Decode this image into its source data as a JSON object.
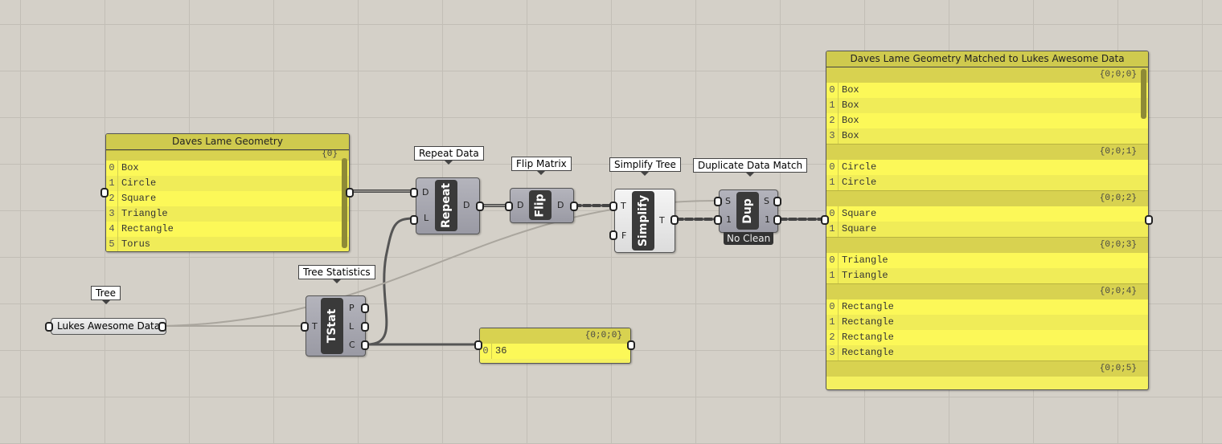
{
  "panel_geometry": {
    "title": "Daves Lame Geometry",
    "path": "{0}",
    "items": [
      "Box",
      "Circle",
      "Square",
      "Triangle",
      "Rectangle",
      "Torus"
    ]
  },
  "repeat": {
    "tooltip": "Repeat Data",
    "name": "Repeat",
    "inputs": [
      "D",
      "L"
    ],
    "outputs": [
      "D"
    ]
  },
  "flip": {
    "tooltip": "Flip Matrix",
    "name": "Flip",
    "inputs": [
      "D"
    ],
    "outputs": [
      "D"
    ]
  },
  "simplify": {
    "tooltip": "Simplify Tree",
    "name": "Simplify",
    "inputs": [
      "T",
      "F"
    ],
    "outputs": [
      "T"
    ]
  },
  "dup": {
    "tooltip": "Duplicate Data Match",
    "name": "Dup",
    "inputs": [
      "S",
      "1"
    ],
    "outputs": [
      "S",
      "1"
    ],
    "label": "No Clean"
  },
  "tree_param": {
    "tooltip": "Tree",
    "name": "Lukes Awesome Data"
  },
  "tstat": {
    "tooltip": "Tree Statistics",
    "name": "TStat",
    "inputs": [
      "T"
    ],
    "outputs": [
      "P",
      "L",
      "C"
    ]
  },
  "panel_count": {
    "path": "{0;0;0}",
    "items": [
      "36"
    ]
  },
  "panel_result": {
    "title": "Daves Lame Geometry Matched to Lukes Awesome Data",
    "branches": [
      {
        "path": "{0;0;0}",
        "items": [
          "Box",
          "Box",
          "Box",
          "Box"
        ]
      },
      {
        "path": "{0;0;1}",
        "items": [
          "Circle",
          "Circle"
        ]
      },
      {
        "path": "{0;0;2}",
        "items": [
          "Square",
          "Square"
        ]
      },
      {
        "path": "{0;0;3}",
        "items": [
          "Triangle",
          "Triangle"
        ]
      },
      {
        "path": "{0;0;4}",
        "items": [
          "Rectangle",
          "Rectangle",
          "Rectangle",
          "Rectangle"
        ]
      },
      {
        "path": "{0;0;5}",
        "items": []
      }
    ]
  },
  "colors": {
    "canvas": "#d4d0c8",
    "panel": "#f4f060",
    "component": "#a8a8b0"
  }
}
